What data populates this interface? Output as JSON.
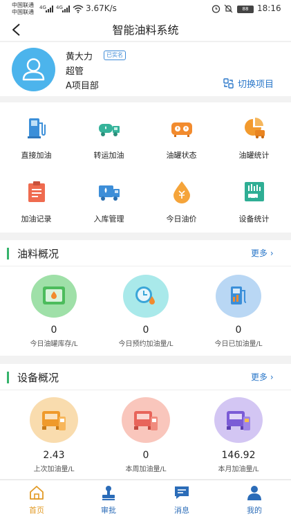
{
  "status_bar": {
    "carrier_1": "中国联通",
    "carrier_2": "中国联通",
    "signal_1": "4G",
    "signal_2": "4G",
    "net_speed": "3.67K/s",
    "battery": "88",
    "time": "18:16"
  },
  "header": {
    "title": "智能油料系统"
  },
  "profile": {
    "name": "黄大力",
    "verified_badge": "已实名",
    "role": "超管",
    "project": "A项目部",
    "switch_label": "切换项目"
  },
  "menu": {
    "items": [
      {
        "label": "直接加油",
        "icon": "fuel-pump-icon"
      },
      {
        "label": "转运加油",
        "icon": "tanker-truck-icon"
      },
      {
        "label": "油罐状态",
        "icon": "tank-status-icon"
      },
      {
        "label": "油罐统计",
        "icon": "tank-statistics-icon"
      },
      {
        "label": "加油记录",
        "icon": "clipboard-record-icon"
      },
      {
        "label": "入库管理",
        "icon": "storage-truck-icon"
      },
      {
        "label": "今日油价",
        "icon": "oil-price-drop-icon"
      },
      {
        "label": "设备统计",
        "icon": "equipment-statistics-icon"
      }
    ]
  },
  "fuel_overview": {
    "title": "油料概况",
    "more": "更多",
    "stats": [
      {
        "value": "0",
        "label": "今日油罐库存/L",
        "icon": "tank-stock-icon"
      },
      {
        "value": "0",
        "label": "今日预约加油量/L",
        "icon": "clock-reservation-icon"
      },
      {
        "value": "0",
        "label": "今日已加油量/L",
        "icon": "fuel-pump-chart-icon"
      }
    ]
  },
  "equipment_overview": {
    "title": "设备概况",
    "more": "更多",
    "stats": [
      {
        "value": "2.43",
        "label": "上次加油量/L",
        "icon": "truck-fuel-icon"
      },
      {
        "value": "0",
        "label": "本周加油量/L",
        "icon": "truck-fuel-icon"
      },
      {
        "value": "146.92",
        "label": "本月加油量/L",
        "icon": "truck-fuel-icon"
      }
    ]
  },
  "tabs": [
    {
      "label": "首页",
      "icon": "home-icon",
      "active": true
    },
    {
      "label": "审批",
      "icon": "stamp-icon",
      "active": false
    },
    {
      "label": "消息",
      "icon": "message-icon",
      "active": false
    },
    {
      "label": "我的",
      "icon": "user-icon",
      "active": false
    }
  ],
  "colors": {
    "accent_blue": "#2a77c9",
    "section_bar_green": "#35b36b",
    "active_tab": "#e29a25",
    "avatar_bg": "#4cb4ec"
  }
}
